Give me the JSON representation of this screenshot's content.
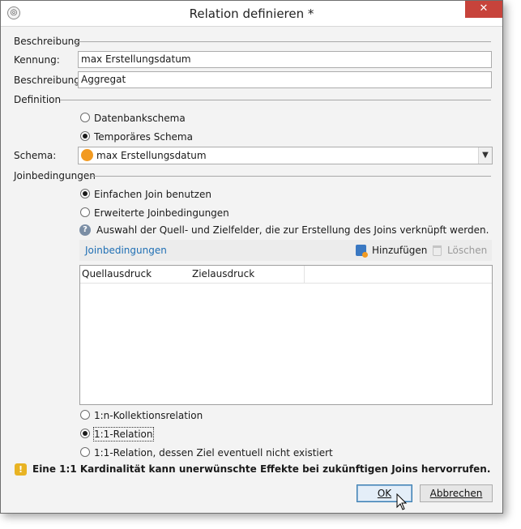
{
  "window": {
    "title": "Relation definieren *",
    "close_label": "✕"
  },
  "sections": {
    "beschreibung": "Beschreibung",
    "definition": "Definition",
    "joinbedingungen": "Joinbedingungen"
  },
  "fields": {
    "kennung_label": "Kennung:",
    "kennung_value": "max Erstellungsdatum",
    "beschreibung_label": "Beschreibung:",
    "beschreibung_value": "Aggregat",
    "schema_label": "Schema:",
    "schema_value": "max Erstellungsdatum"
  },
  "definition_options": [
    {
      "label": "Datenbankschema",
      "selected": false
    },
    {
      "label": "Temporäres Schema",
      "selected": true
    }
  ],
  "join_options": [
    {
      "label": "Einfachen Join benutzen",
      "selected": true
    },
    {
      "label": "Erweiterte Joinbedingungen",
      "selected": false
    }
  ],
  "join_help": "Auswahl der Quell- und Zielfelder, die zur Erstellung des Joins verknüpft werden.",
  "join_toolbar": {
    "link": "Joinbedingungen",
    "add_label": "Hinzufügen",
    "delete_label": "Löschen"
  },
  "join_table": {
    "columns": [
      "Quellausdruck",
      "Zielausdruck"
    ],
    "rows": []
  },
  "cardinality_options": [
    {
      "label": "1:n-Kollektionsrelation",
      "selected": false
    },
    {
      "label": "1:1-Relation",
      "selected": true
    },
    {
      "label": "1:1-Relation, dessen Ziel eventuell nicht existiert",
      "selected": false
    }
  ],
  "warning": "Eine 1:1 Kardinalität kann unerwünschte Effekte bei zukünftigen Joins hervorrufen.",
  "buttons": {
    "ok": "OK",
    "cancel": "Abbrechen"
  },
  "icons": {
    "app": "app-icon",
    "help": "help-icon",
    "warning": "warning-icon",
    "add": "add-icon",
    "delete": "trash-icon",
    "schema": "schema-dot-icon"
  },
  "colors": {
    "schema_dot": "#f29a21",
    "link": "#1f6fb4",
    "close": "#c7433b",
    "warning": "#e8b323"
  }
}
